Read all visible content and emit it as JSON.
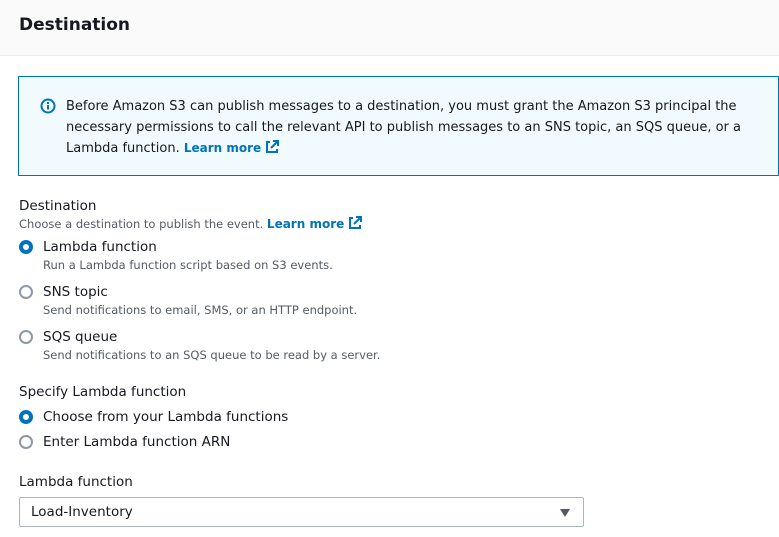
{
  "header": {
    "title": "Destination"
  },
  "info": {
    "text": "Before Amazon S3 can publish messages to a destination, you must grant the Amazon S3 principal the necessary permissions to call the relevant API to publish messages to an SNS topic, an SQS queue, or a Lambda function.",
    "link": "Learn more",
    "icon": "info-icon"
  },
  "destination": {
    "label": "Destination",
    "description": "Choose a destination to publish the event.",
    "link": "Learn more",
    "selected": "lambda",
    "options": [
      {
        "id": "lambda",
        "label": "Lambda function",
        "description": "Run a Lambda function script based on S3 events."
      },
      {
        "id": "sns",
        "label": "SNS topic",
        "description": "Send notifications to email, SMS, or an HTTP endpoint."
      },
      {
        "id": "sqs",
        "label": "SQS queue",
        "description": "Send notifications to an SQS queue to be read by a server."
      }
    ]
  },
  "specify": {
    "label": "Specify Lambda function",
    "selected": "choose",
    "options": [
      {
        "id": "choose",
        "label": "Choose from your Lambda functions"
      },
      {
        "id": "arn",
        "label": "Enter Lambda function ARN"
      }
    ]
  },
  "lambda_function": {
    "label": "Lambda function",
    "value": "Load-Inventory"
  },
  "colors": {
    "accent": "#0073bb",
    "info_bg": "#f1faff",
    "muted": "#545b64"
  }
}
